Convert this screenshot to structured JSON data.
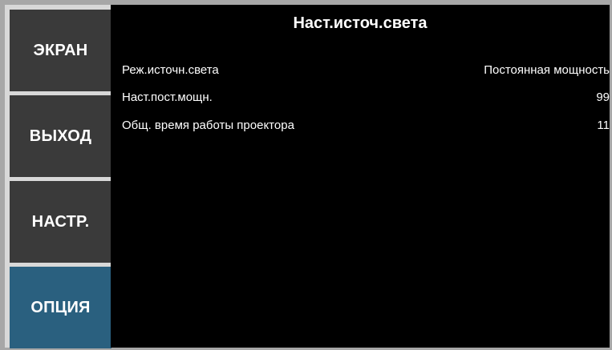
{
  "sidebar": {
    "tabs": [
      {
        "label": "ЭКРАН",
        "active": false
      },
      {
        "label": "ВЫХОД",
        "active": false
      },
      {
        "label": "НАСТР.",
        "active": false
      },
      {
        "label": "ОПЦИЯ",
        "active": true
      }
    ]
  },
  "panel": {
    "title": "Наст.источ.света",
    "rows": [
      {
        "label": "Реж.источн.света",
        "value": "Постоянная мощность"
      },
      {
        "label": "Наст.пост.мощн.",
        "value": "99"
      },
      {
        "label": "Общ. время работы проектора",
        "value": "11"
      }
    ]
  },
  "colors": {
    "background": "#000000",
    "tab_inactive": "#3a3a3a",
    "tab_active": "#2a607f",
    "frame": "#a7a7a7",
    "text": "#ffffff"
  }
}
